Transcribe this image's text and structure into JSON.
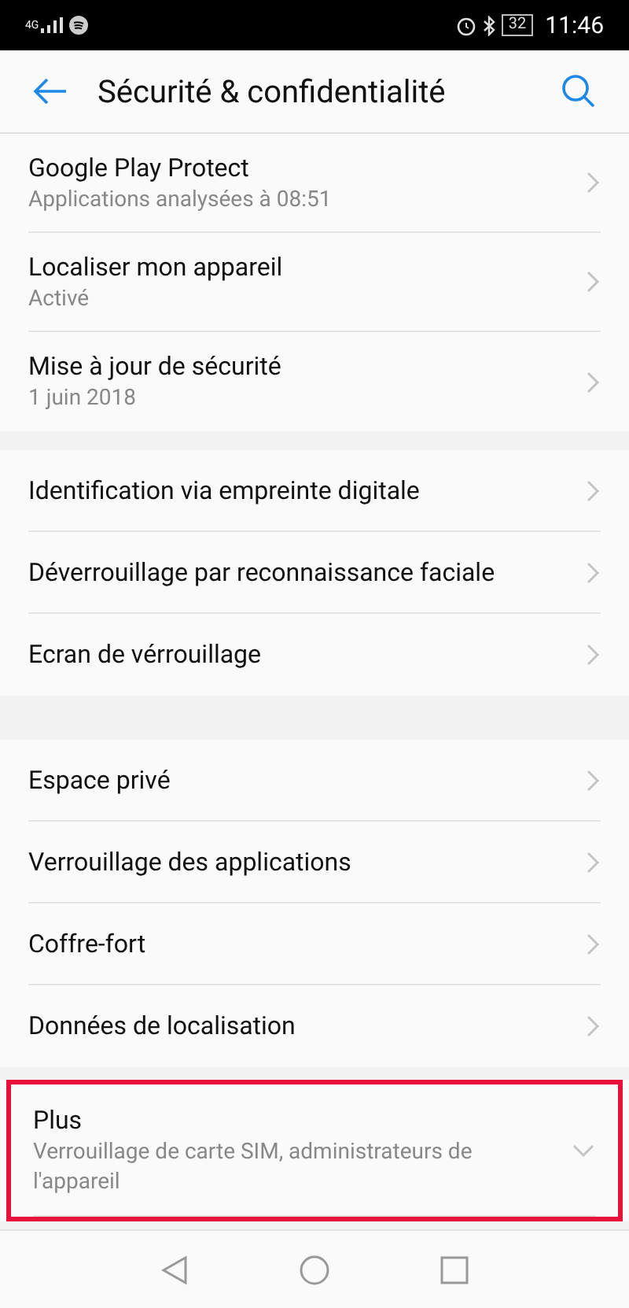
{
  "status_bar": {
    "network": "4G",
    "battery": "32",
    "time": "11:46"
  },
  "header": {
    "title": "Sécurité & confidentialité"
  },
  "groups": [
    {
      "items": [
        {
          "kind": "link",
          "title": "Google Play Protect",
          "subtitle": "Applications analysées à 08:51"
        },
        {
          "kind": "link",
          "title": "Localiser mon appareil",
          "subtitle": "Activé"
        },
        {
          "kind": "link",
          "title": "Mise à jour de sécurité",
          "subtitle": "1 juin 2018"
        }
      ]
    },
    {
      "items": [
        {
          "kind": "link",
          "title": "Identification via empreinte digitale"
        },
        {
          "kind": "link",
          "title": "Déverrouillage par reconnaissance faciale"
        },
        {
          "kind": "link",
          "title": "Ecran de vérrouillage"
        }
      ]
    },
    {
      "items": [
        {
          "kind": "link",
          "title": "Espace privé"
        },
        {
          "kind": "link",
          "title": "Verrouillage des applications"
        },
        {
          "kind": "link",
          "title": "Coffre-fort"
        },
        {
          "kind": "link",
          "title": "Données de localisation"
        }
      ]
    },
    {
      "items": [
        {
          "kind": "expand",
          "highlighted": true,
          "title": "Plus",
          "subtitle": "Verrouillage de carte SIM, administrateurs de l'appareil"
        }
      ]
    }
  ]
}
